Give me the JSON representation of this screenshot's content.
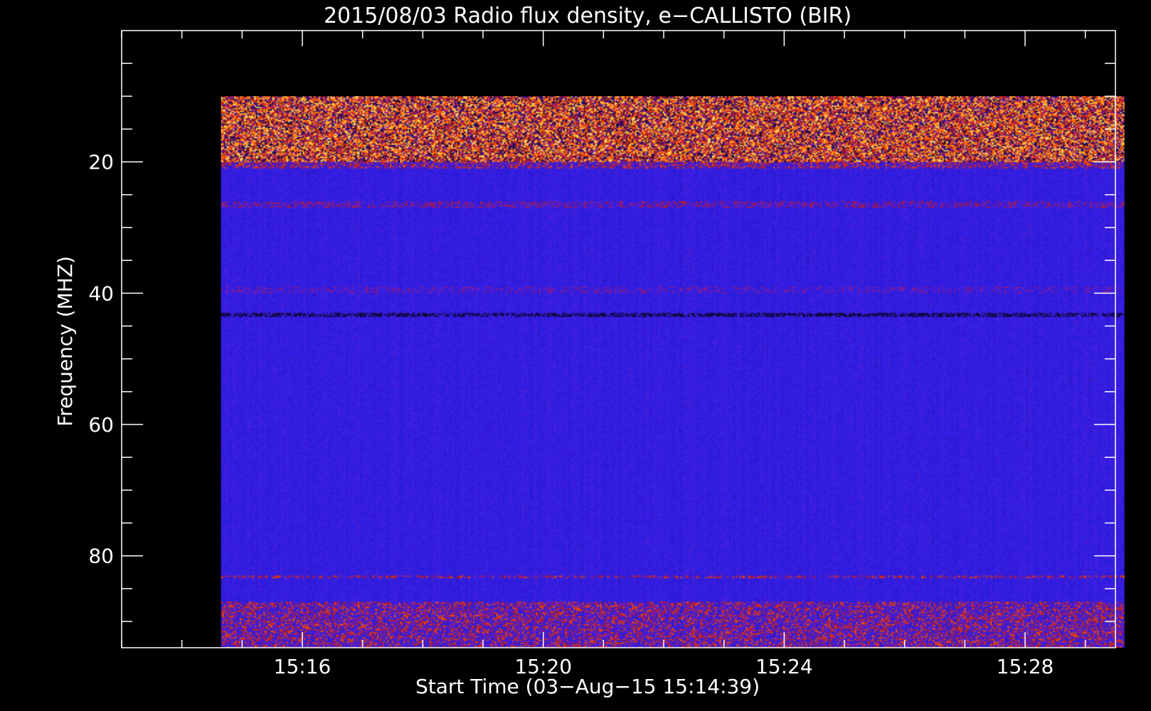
{
  "chart_data": {
    "type": "heatmap",
    "title": "2015/08/03  Radio flux density, e−CALLISTO (BIR)",
    "xlabel": "Start Time (03−Aug−15 15:14:39)",
    "ylabel": "Frequency (MHZ)",
    "x_axis": {
      "unit": "minutes of day",
      "range": [
        "15:13:00",
        "15:29:30"
      ],
      "data_range": [
        "15:14:39",
        "15:29:39"
      ],
      "major_ticks": [
        "15:16",
        "15:20",
        "15:24",
        "15:28"
      ],
      "minor_tick_step_min": 1
    },
    "y_axis": {
      "inverted": true,
      "range": [
        0,
        94
      ],
      "data_range": [
        10,
        94
      ],
      "major_ticks": [
        20,
        40,
        60,
        80
      ],
      "minor_tick_step": 5
    },
    "colormap": [
      "#000000",
      "#1a0a5a",
      "#2a1ad8",
      "#3a20e6",
      "#8a1a9a",
      "#c01a10",
      "#ff5a00",
      "#ffb020",
      "#ffffa0"
    ],
    "features": [
      {
        "band": [
          10,
          20
        ],
        "level": "high",
        "note": "intense interference at top"
      },
      {
        "band": [
          20,
          21
        ],
        "level": "mid"
      },
      {
        "band": [
          26,
          27
        ],
        "level": "mid-low"
      },
      {
        "band": [
          39,
          40
        ],
        "level": "low"
      },
      {
        "band": [
          43,
          43.5
        ],
        "level": "dark"
      },
      {
        "band": [
          83,
          83.5
        ],
        "level": "mid"
      },
      {
        "band": [
          87,
          94
        ],
        "level": "mid",
        "note": "interference at bottom"
      }
    ],
    "grid": false,
    "legend": "none"
  }
}
